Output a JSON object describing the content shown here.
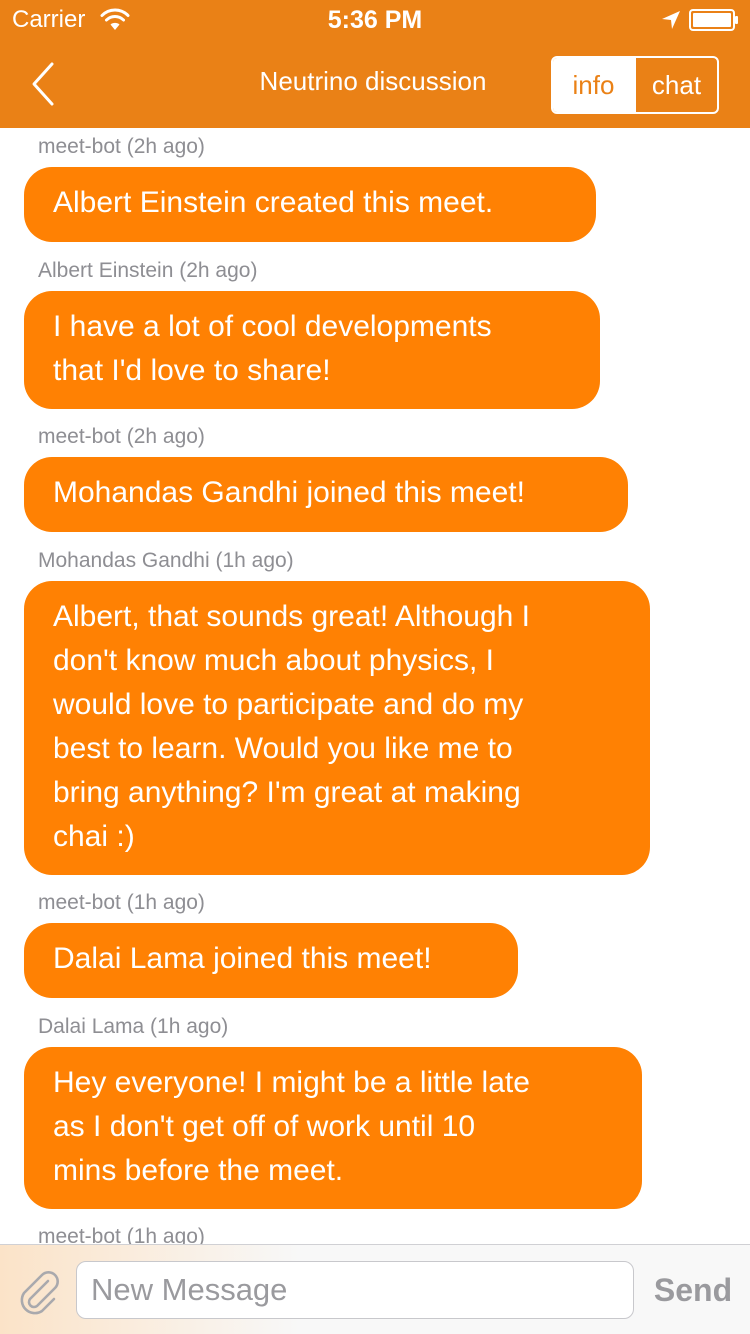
{
  "status_bar": {
    "carrier": "Carrier",
    "time": "5:36 PM"
  },
  "nav": {
    "title": "Neutrino discussion",
    "segments": [
      {
        "label": "info",
        "selected": true
      },
      {
        "label": "chat",
        "selected": false
      }
    ]
  },
  "messages": [
    {
      "sender": "meet-bot (2h ago)",
      "lines": [
        "Albert Einstein created this meet."
      ]
    },
    {
      "sender": "Albert Einstein (2h ago)",
      "lines": [
        "I have a lot of cool developments",
        "that I'd love to share!"
      ]
    },
    {
      "sender": "meet-bot (2h ago)",
      "lines": [
        "Mohandas Gandhi joined this meet!"
      ]
    },
    {
      "sender": "Mohandas Gandhi (1h ago)",
      "lines": [
        "Albert, that sounds great! Although I",
        "don't know much about physics, I",
        "would love to participate and do my",
        "best to learn. Would you like me to",
        "bring anything? I'm great at making",
        "chai :)"
      ]
    },
    {
      "sender": "meet-bot (1h ago)",
      "lines": [
        "Dalai Lama joined this meet!"
      ]
    },
    {
      "sender": "Dalai Lama (1h ago)",
      "lines": [
        "Hey everyone! I might be a little late",
        "as I don't get off of work until 10",
        "mins before the meet."
      ]
    },
    {
      "sender": "meet-bot (1h ago)",
      "lines": []
    }
  ],
  "composer": {
    "placeholder": "New Message",
    "send_label": "Send"
  },
  "colors": {
    "nav_background": "#EA8116",
    "bubble": "#FF8103",
    "sender_text": "#8e8e93"
  }
}
